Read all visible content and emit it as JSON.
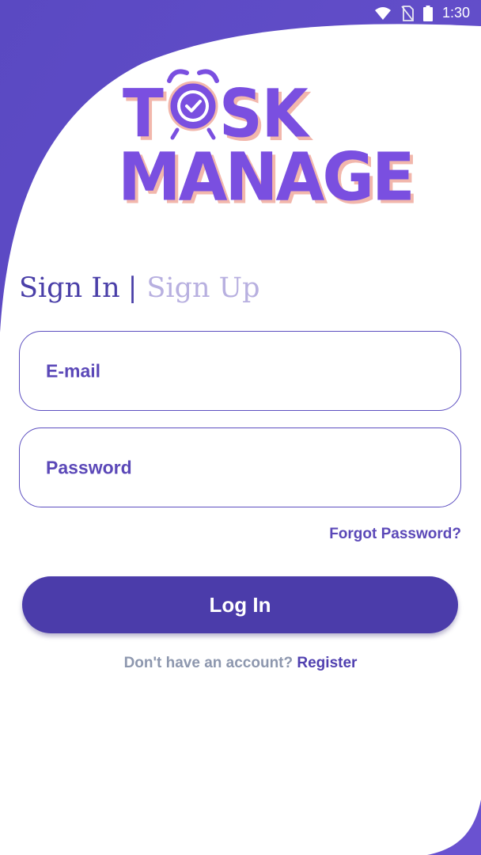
{
  "status_bar": {
    "time": "1:30",
    "icons": [
      "wifi-icon",
      "no-sim-icon",
      "battery-icon"
    ]
  },
  "logo": {
    "line1_left": "T",
    "line1_right": "SK",
    "line2": "MANAGE",
    "icon": "alarm-clock-check-icon"
  },
  "tabs": {
    "sign_in": "Sign In",
    "separator": "|",
    "sign_up": "Sign Up"
  },
  "form": {
    "email_placeholder": "E-mail",
    "password_placeholder": "Password",
    "forgot_password": "Forgot Password?",
    "login_label": "Log In",
    "no_account_text": "Don't have an account?",
    "register_label": "Register"
  },
  "colors": {
    "primary": "#4b3caa",
    "accent_purple": "#7a4fe0",
    "background_shape": "#5b4cc4",
    "muted_text": "#8d97ae",
    "inactive_tab": "#b8b0e0"
  }
}
